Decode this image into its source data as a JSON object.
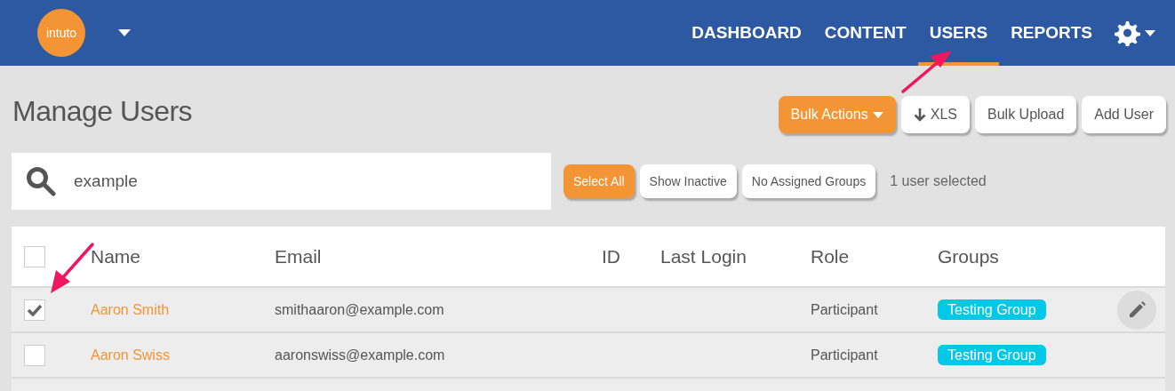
{
  "header": {
    "logo": "intuto",
    "nav": [
      {
        "label": "DASHBOARD",
        "selected": false
      },
      {
        "label": "CONTENT",
        "selected": false
      },
      {
        "label": "USERS",
        "selected": true
      },
      {
        "label": "REPORTS",
        "selected": false
      }
    ]
  },
  "page_title": "Manage Users",
  "actions": [
    {
      "label": "Bulk Actions",
      "kind": "primary"
    },
    {
      "label": "XLS",
      "kind": "download"
    },
    {
      "label": "Bulk Upload",
      "kind": "plain"
    },
    {
      "label": "Add User",
      "kind": "plain"
    }
  ],
  "search": {
    "value": "example"
  },
  "filters": [
    {
      "label": "Select All",
      "selected": true
    },
    {
      "label": "Show Inactive",
      "selected": false
    },
    {
      "label": "No Assigned Groups",
      "selected": false
    }
  ],
  "selection_status": "1 user selected",
  "table": {
    "columns": [
      "Name",
      "Email",
      "ID",
      "Last Login",
      "Role",
      "Groups"
    ],
    "select_all_checked": false,
    "rows": [
      {
        "checked": true,
        "name": "Aaron Smith",
        "email": "smithaaron@example.com",
        "role": "Participant",
        "groups": [
          "Testing Group"
        ],
        "hovered": true
      },
      {
        "checked": false,
        "name": "Aaron Swiss",
        "email": "aaronswiss@example.com",
        "role": "Participant",
        "groups": [
          "Testing Group"
        ],
        "hovered": false
      }
    ]
  }
}
